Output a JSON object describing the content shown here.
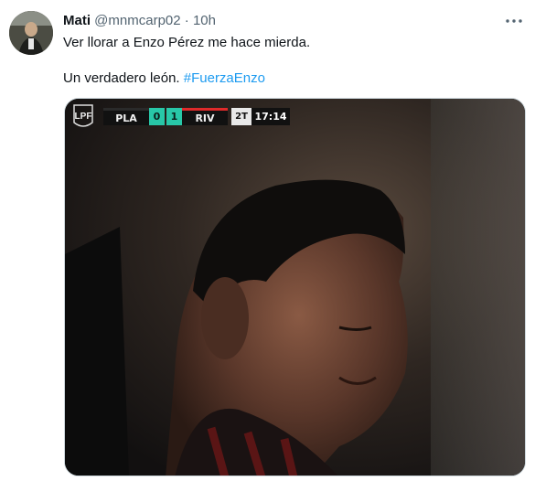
{
  "author": {
    "name": "Mati",
    "handle": "@mnmcarp02",
    "separator": "·",
    "time": "10h"
  },
  "tweet": {
    "line1": "Ver llorar a Enzo Pérez me hace mierda.",
    "line2_text": "Un verdadero león. ",
    "hashtag": "#FuerzaEnzo"
  },
  "media": {
    "league_logo_text": "LPF",
    "scorebug": {
      "home_team": "PLA",
      "home_score": "0",
      "away_score": "1",
      "away_team": "RIV",
      "period": "2T",
      "clock": "17:14"
    }
  },
  "colors": {
    "hashtag": "#1d9bf0",
    "score_bg": "#28c7a8",
    "away_accent": "#e02a2a"
  },
  "icons": {
    "more": "more-horizontal-icon",
    "avatar": "avatar"
  }
}
